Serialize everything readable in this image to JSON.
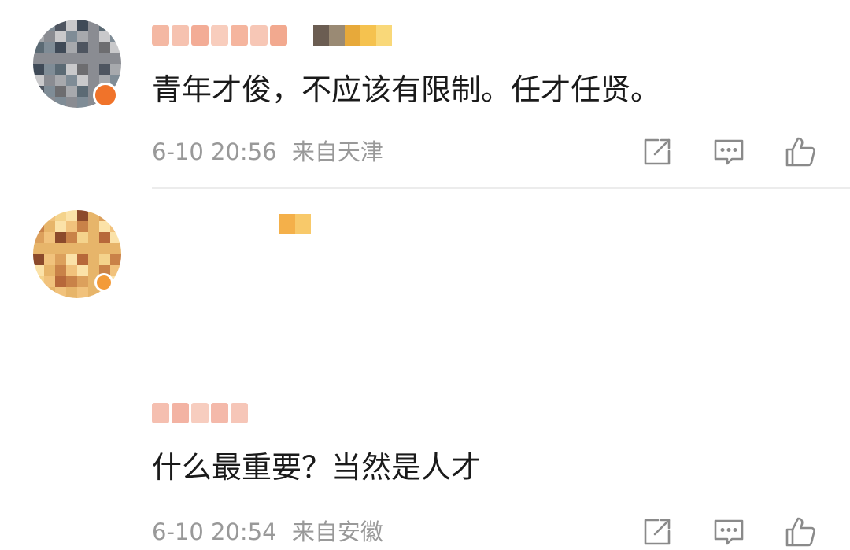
{
  "comments": [
    {
      "content": "青年才俊，不应该有限制。任才任贤。",
      "date": "6-10 20:56",
      "location": "来自天津",
      "avatar_colors": [
        "#6d6d70",
        "#8a8c92",
        "#4e5560",
        "#a7a9ad",
        "#3f4a57",
        "#7f8c96",
        "#5b6a74",
        "#c9c9cb"
      ],
      "verified_color": "#f0732a",
      "name_colors": [
        "#f4b8a3",
        "#f6c2b0",
        "#f3ac96",
        "#f8cdbd",
        "#f5b59e",
        "#f7c7b6",
        "#f2a98f"
      ],
      "badge_colors": [
        "#6b5d52",
        "#9a8a74",
        "#e7a93a",
        "#f5c24f",
        "#f9d879"
      ]
    },
    {
      "content": "什么最重要？当然是人才",
      "date": "6-10 20:54",
      "location": "来自安徽",
      "avatar_colors": [
        "#b7683a",
        "#e7b56a",
        "#f4d38c",
        "#c98248",
        "#8c4a2b",
        "#f1c27c",
        "#dca05c",
        "#fbe2a8"
      ],
      "verified_color": "#f39b39",
      "name_colors": [
        "#f5bfb0",
        "#f3b3a3",
        "#f7cdbf",
        "#f4b9aa",
        "#f6c6b8"
      ],
      "badge_colors": [
        "#f4b04a",
        "#f8c96a"
      ]
    }
  ],
  "icons": {
    "share": "share-icon",
    "comment": "comment-icon",
    "like": "like-icon"
  }
}
